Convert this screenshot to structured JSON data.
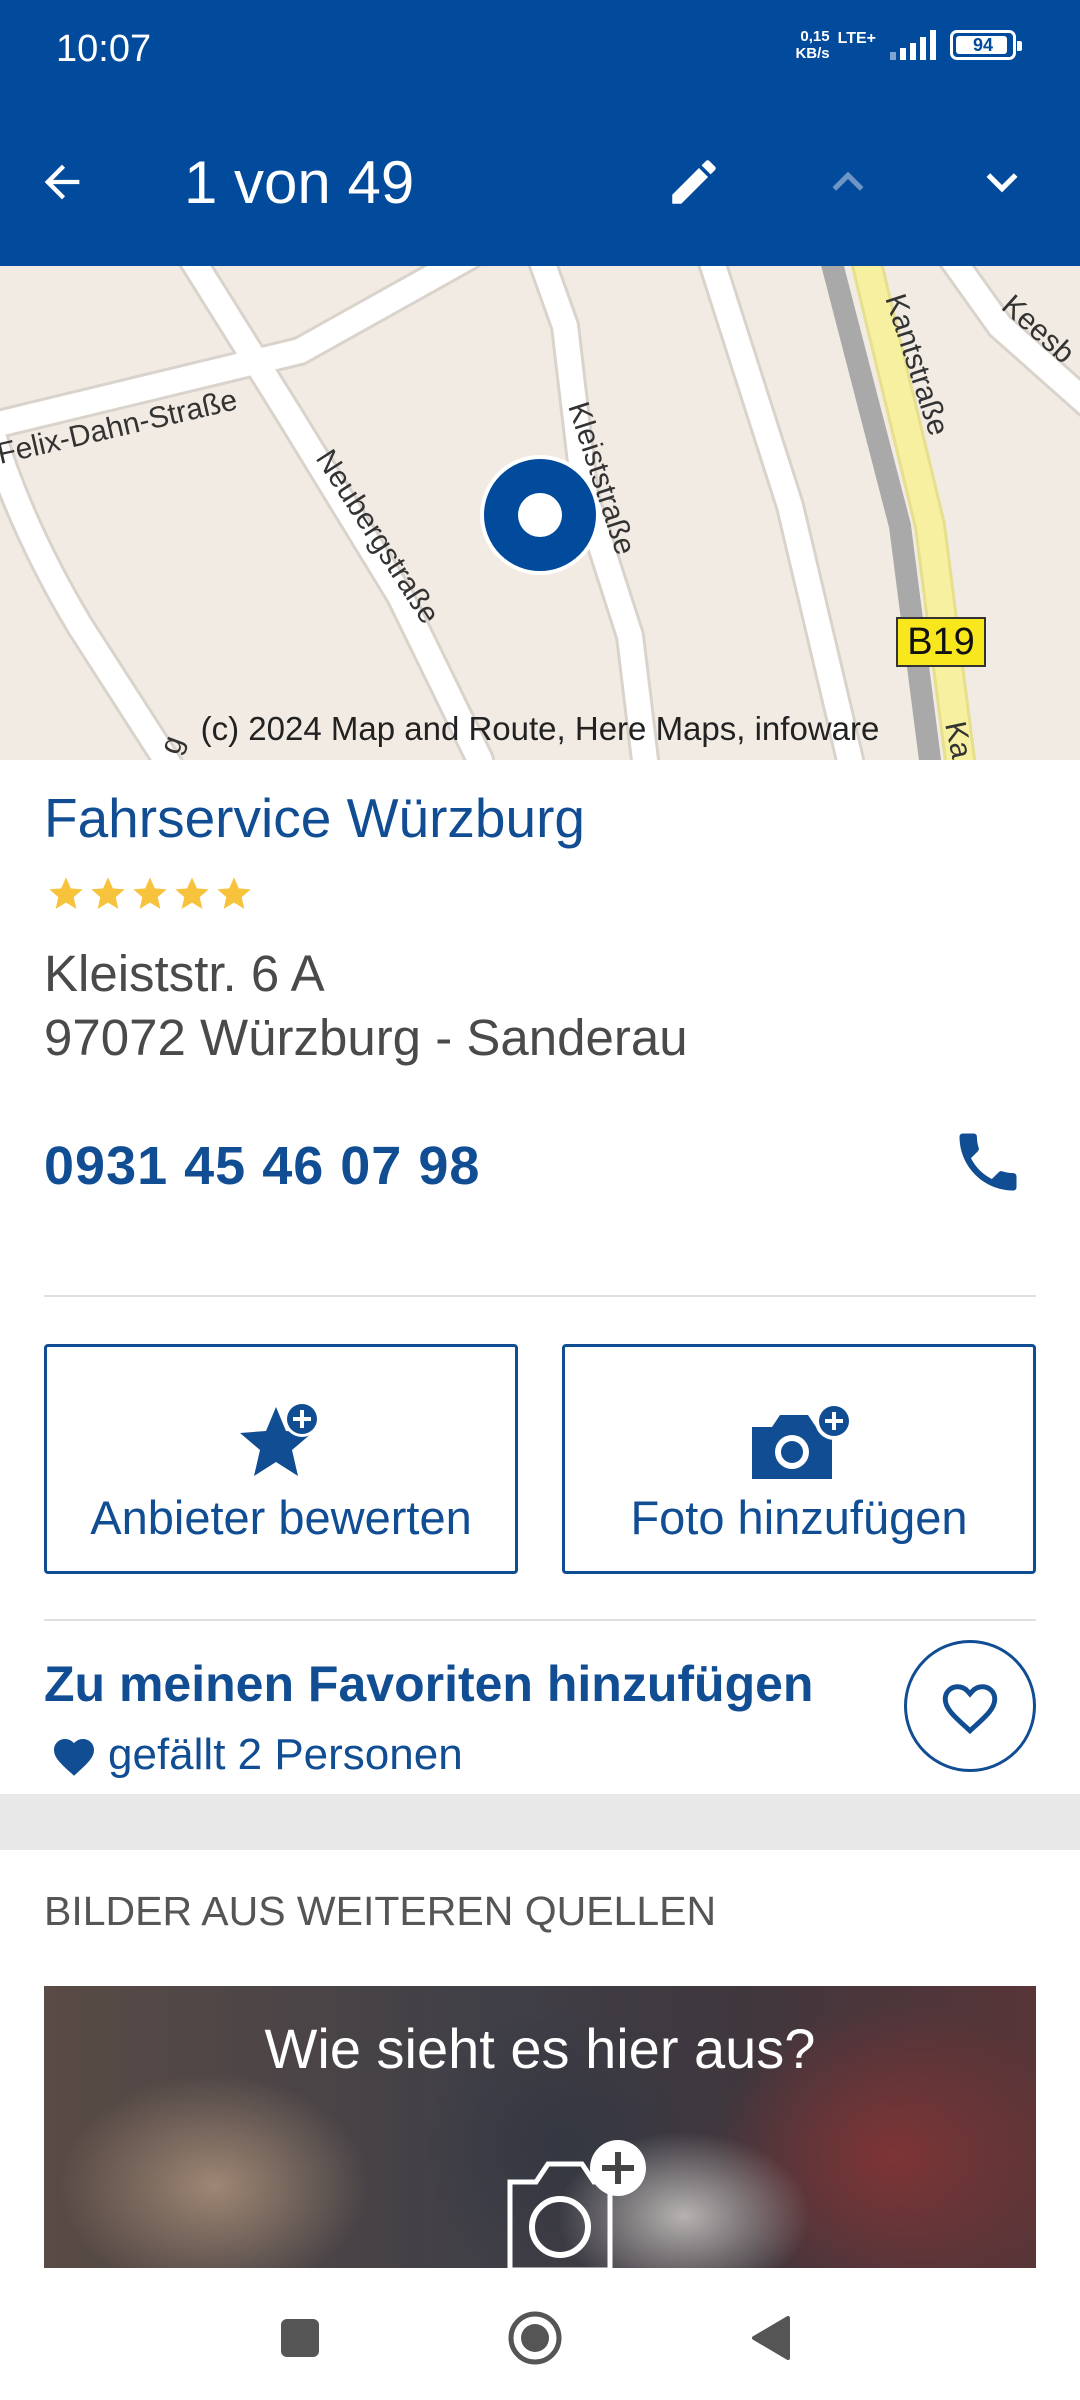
{
  "status_bar": {
    "time": "10:07",
    "net_speed_value": "0,15",
    "net_speed_unit": "KB/s",
    "network": "LTE+",
    "battery_level": "94",
    "battery_fraction": 0.94
  },
  "app_bar": {
    "title": "1 von 49",
    "back_icon": "arrow-back-icon",
    "edit_icon": "pencil-icon",
    "prev_icon": "chevron-up-icon",
    "next_icon": "chevron-down-icon"
  },
  "map": {
    "street_labels": [
      "Felix-Dahn-Straße",
      "Neubergstraße",
      "Kleiststraße",
      "Kantstraße",
      "Keesb",
      "B19",
      "Ka",
      "g"
    ],
    "attribution": "(c) 2024 Map and Route, Here Maps, infoware"
  },
  "listing": {
    "name": "Fahrservice Würzburg",
    "rating": 5,
    "rating_max": 5,
    "address_street": "Kleiststr. 6 A",
    "address_city": "97072 Würzburg - Sanderau",
    "phone": "0931 45 46 07 98"
  },
  "actions": {
    "rate_label": "Anbieter bewerten",
    "photo_label": "Foto hinzufügen"
  },
  "favorites": {
    "label": "Zu meinen Favoriten hinzufügen",
    "likes_text": "gefällt 2 Personen"
  },
  "other_sources": {
    "title": "BILDER AUS WEITEREN QUELLEN",
    "teaser_text": "Wie sieht es hier aus?"
  },
  "colors": {
    "brand_blue": "#014a9c",
    "link_blue": "#114d93",
    "star_yellow": "#f7c33c",
    "map_background": "#f1ebe3",
    "highway_yellow": "#f6f0a0"
  }
}
